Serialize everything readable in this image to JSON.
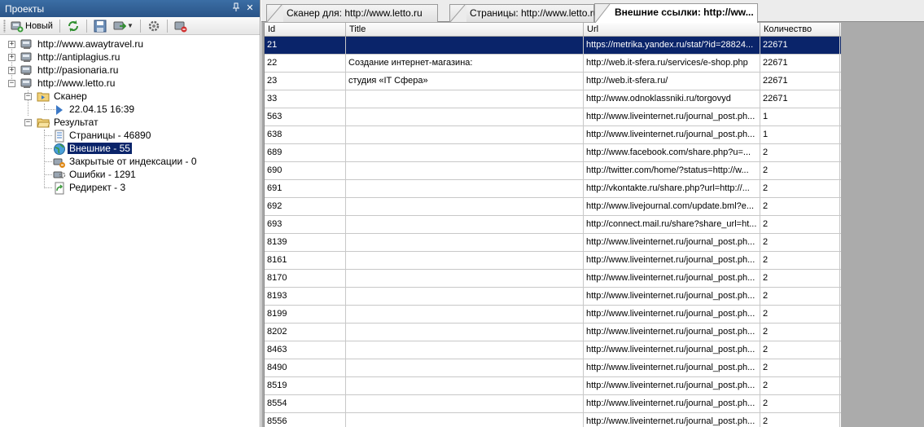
{
  "panel": {
    "title": "Проекты",
    "pin_glyph": "⌂",
    "close_glyph": "✕"
  },
  "toolbar": {
    "new_label": "Новый",
    "icons": [
      "new-project-icon",
      "refresh-icon",
      "save-icon",
      "export-icon",
      "dropdown-icon",
      "settings-icon",
      "delete-icon"
    ]
  },
  "tree": {
    "projects": [
      {
        "label": "http://www.awaytravel.ru",
        "expander": "+"
      },
      {
        "label": "http://antiplagius.ru",
        "expander": "+"
      },
      {
        "label": "http://pasionaria.ru",
        "expander": "+"
      },
      {
        "label": "http://www.letto.ru",
        "expander": "−"
      }
    ],
    "scanner": {
      "label": "Сканер",
      "expander": "−",
      "child": "22.04.15 16:39"
    },
    "result": {
      "label": "Результат",
      "expander": "−",
      "items": [
        {
          "label": "Страницы - 46890",
          "icon": "pages-icon"
        },
        {
          "label": "Внешние - 55",
          "icon": "external-links-icon",
          "selected": true
        },
        {
          "label": "Закрытые от индексации - 0",
          "icon": "blocked-icon"
        },
        {
          "label": "Ошибки - 1291",
          "icon": "error-icon"
        },
        {
          "label": "Редирект - 3",
          "icon": "redirect-icon"
        }
      ]
    }
  },
  "tabs": [
    {
      "label": "Сканер для: http://www.letto.ru",
      "active": false
    },
    {
      "label": "Страницы: http://www.letto.ru",
      "active": false
    },
    {
      "label": "Внешние ссылки: http://ww...",
      "active": true
    }
  ],
  "grid": {
    "columns": [
      "Id",
      "Title",
      "Url",
      "Количество"
    ],
    "rows": [
      {
        "id": "21",
        "title": "",
        "url": "https://metrika.yandex.ru/stat/?id=28824...",
        "count": "22671",
        "selected": true
      },
      {
        "id": "22",
        "title": "Создание интернет-магазина:",
        "url": "http://web.it-sfera.ru/services/e-shop.php",
        "count": "22671"
      },
      {
        "id": "23",
        "title": "студия «IT Сфера»",
        "url": "http://web.it-sfera.ru/",
        "count": "22671"
      },
      {
        "id": "33",
        "title": "",
        "url": "http://www.odnoklassniki.ru/torgovyd",
        "count": "22671"
      },
      {
        "id": "563",
        "title": "",
        "url": "http://www.liveinternet.ru/journal_post.ph...",
        "count": "1"
      },
      {
        "id": "638",
        "title": "",
        "url": "http://www.liveinternet.ru/journal_post.ph...",
        "count": "1"
      },
      {
        "id": "689",
        "title": "",
        "url": "http://www.facebook.com/share.php?u=...",
        "count": "2"
      },
      {
        "id": "690",
        "title": "",
        "url": "http://twitter.com/home/?status=http://w...",
        "count": "2"
      },
      {
        "id": "691",
        "title": "",
        "url": "http://vkontakte.ru/share.php?url=http://...",
        "count": "2"
      },
      {
        "id": "692",
        "title": "",
        "url": "http://www.livejournal.com/update.bml?e...",
        "count": "2"
      },
      {
        "id": "693",
        "title": "",
        "url": "http://connect.mail.ru/share?share_url=ht...",
        "count": "2"
      },
      {
        "id": "8139",
        "title": "",
        "url": "http://www.liveinternet.ru/journal_post.ph...",
        "count": "2"
      },
      {
        "id": "8161",
        "title": "",
        "url": "http://www.liveinternet.ru/journal_post.ph...",
        "count": "2"
      },
      {
        "id": "8170",
        "title": "",
        "url": "http://www.liveinternet.ru/journal_post.ph...",
        "count": "2"
      },
      {
        "id": "8193",
        "title": "",
        "url": "http://www.liveinternet.ru/journal_post.ph...",
        "count": "2"
      },
      {
        "id": "8199",
        "title": "",
        "url": "http://www.liveinternet.ru/journal_post.ph...",
        "count": "2"
      },
      {
        "id": "8202",
        "title": "",
        "url": "http://www.liveinternet.ru/journal_post.ph...",
        "count": "2"
      },
      {
        "id": "8463",
        "title": "",
        "url": "http://www.liveinternet.ru/journal_post.ph...",
        "count": "2"
      },
      {
        "id": "8490",
        "title": "",
        "url": "http://www.liveinternet.ru/journal_post.ph...",
        "count": "2"
      },
      {
        "id": "8519",
        "title": "",
        "url": "http://www.liveinternet.ru/journal_post.ph...",
        "count": "2"
      },
      {
        "id": "8554",
        "title": "",
        "url": "http://www.liveinternet.ru/journal_post.ph...",
        "count": "2"
      },
      {
        "id": "8556",
        "title": "",
        "url": "http://www.liveinternet.ru/journal_post.ph...",
        "count": "2"
      }
    ]
  },
  "colors": {
    "selection": "#0a246a",
    "panel_header": "#2a5488",
    "workspace": "#ababab"
  }
}
